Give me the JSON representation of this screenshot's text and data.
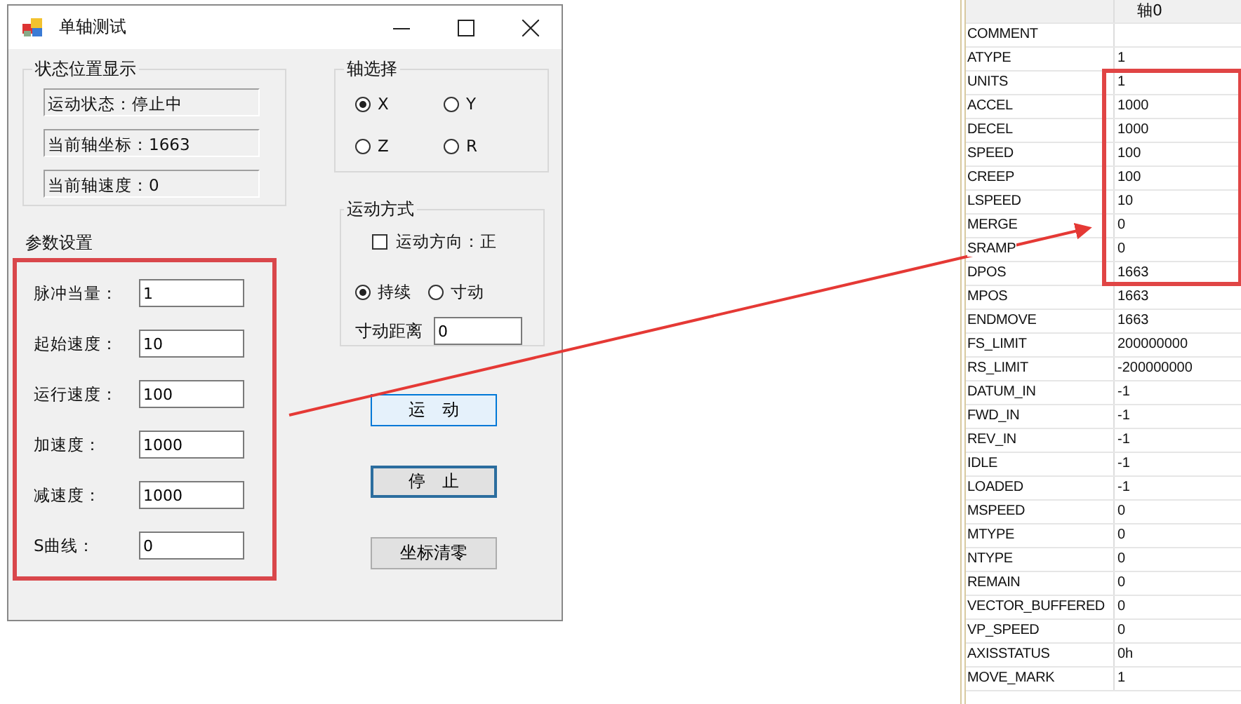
{
  "window": {
    "title": "单轴测试",
    "status_group": {
      "title": "状态位置显示",
      "items": [
        "运动状态：停止中",
        "当前轴坐标：1663",
        "当前轴速度：0"
      ]
    },
    "params_group": {
      "title": "参数设置",
      "rows": [
        {
          "label": "脉冲当量：",
          "value": "1"
        },
        {
          "label": "起始速度：",
          "value": "10"
        },
        {
          "label": "运行速度：",
          "value": "100"
        },
        {
          "label": "加速度：",
          "value": "1000"
        },
        {
          "label": "减速度：",
          "value": "1000"
        },
        {
          "label": "S曲线：",
          "value": "0"
        }
      ]
    },
    "axis_group": {
      "title": "轴选择",
      "options": [
        {
          "label": "X",
          "selected": true
        },
        {
          "label": "Y",
          "selected": false
        },
        {
          "label": "Z",
          "selected": false
        },
        {
          "label": "R",
          "selected": false
        }
      ]
    },
    "motion_group": {
      "title": "运动方式",
      "direction": {
        "label": "运动方向：正",
        "checked": false
      },
      "modes": [
        {
          "label": "持续",
          "selected": true
        },
        {
          "label": "寸动",
          "selected": false
        }
      ],
      "jog": {
        "label": "寸动距离",
        "value": "0"
      }
    },
    "buttons": [
      {
        "label": "运　动",
        "kind": "hover"
      },
      {
        "label": "停　止",
        "kind": "focused"
      },
      {
        "label": "坐标清零",
        "kind": "normal"
      }
    ]
  },
  "table": {
    "column_header": "轴0",
    "rows": [
      {
        "name": "COMMENT"
      },
      {
        "name": "ATYPE",
        "value": "1"
      },
      {
        "name": "UNITS",
        "value": "1"
      },
      {
        "name": "ACCEL",
        "value": "1000"
      },
      {
        "name": "DECEL",
        "value": "1000"
      },
      {
        "name": "SPEED",
        "value": "100"
      },
      {
        "name": "CREEP",
        "value": "100"
      },
      {
        "name": "LSPEED",
        "value": "10"
      },
      {
        "name": "MERGE",
        "value": "0"
      },
      {
        "name": "SRAMP",
        "value": "0"
      },
      {
        "name": "DPOS",
        "value": "1663"
      },
      {
        "name": "MPOS",
        "value": "1663"
      },
      {
        "name": "ENDMOVE",
        "value": "1663"
      },
      {
        "name": "FS_LIMIT",
        "value": "200000000"
      },
      {
        "name": "RS_LIMIT",
        "value": "-200000000"
      },
      {
        "name": "DATUM_IN",
        "value": "-1"
      },
      {
        "name": "FWD_IN",
        "value": "-1"
      },
      {
        "name": "REV_IN",
        "value": "-1"
      },
      {
        "name": "IDLE",
        "value": "-1"
      },
      {
        "name": "LOADED",
        "value": "-1"
      },
      {
        "name": "MSPEED",
        "value": "0"
      },
      {
        "name": "MTYPE",
        "value": "0"
      },
      {
        "name": "NTYPE",
        "value": "0"
      },
      {
        "name": "REMAIN",
        "value": "0"
      },
      {
        "name": "VECTOR_BUFFERED",
        "value": "0"
      },
      {
        "name": "VP_SPEED",
        "value": "0"
      },
      {
        "name": "AXISSTATUS",
        "value": "0h"
      },
      {
        "name": "MOVE_MARK",
        "value": "1"
      }
    ]
  }
}
